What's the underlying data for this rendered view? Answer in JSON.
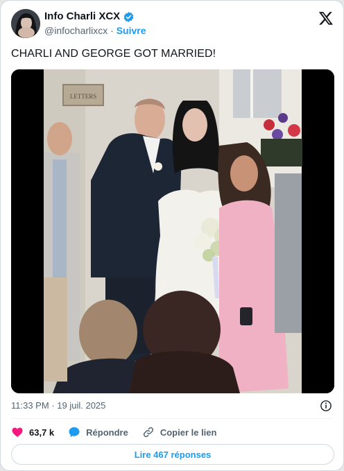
{
  "author": {
    "display_name": "Info Charli XCX",
    "handle": "@infocharlixcx",
    "separator": "·",
    "follow_label": "Suivre"
  },
  "tweet": {
    "text": "CHARLI AND GEORGE GOT MARRIED!",
    "time": "11:33 PM",
    "date_separator": "·",
    "date": "19 juil. 2025"
  },
  "media": {
    "sign_text": "LETTERS"
  },
  "actions": {
    "likes": "63,7 k",
    "reply_label": "Répondre",
    "copy_link_label": "Copier le lien"
  },
  "read_replies_label": "Lire 467 réponses",
  "colors": {
    "accent": "#1d9bf0",
    "like": "#f91880",
    "text": "#0f1419",
    "muted": "#536471"
  },
  "icons": {
    "verified": "verified-badge-icon",
    "brand": "x-logo-icon",
    "info": "info-icon",
    "like": "heart-icon",
    "reply": "speech-bubble-icon",
    "link": "link-icon"
  }
}
